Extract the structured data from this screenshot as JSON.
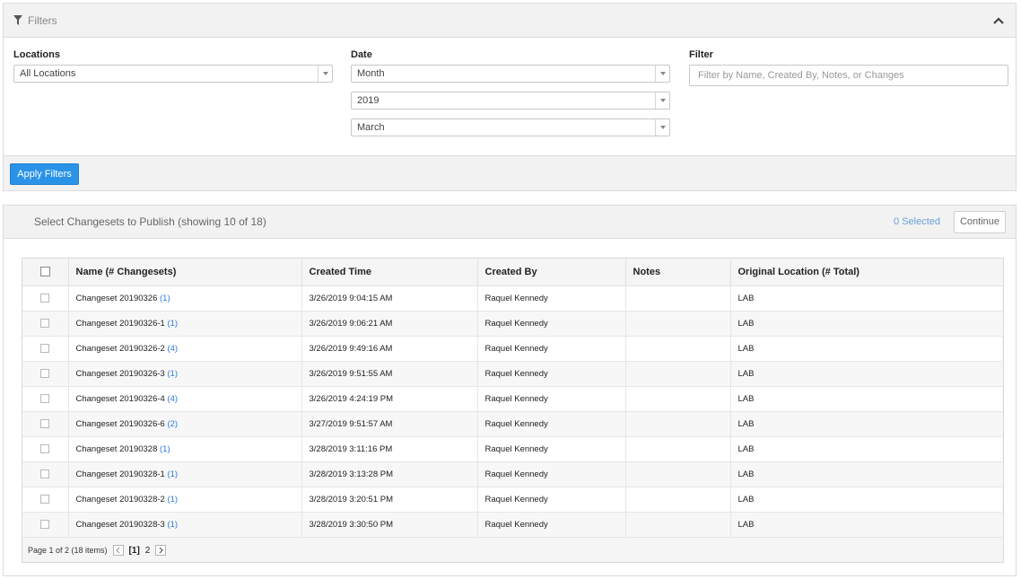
{
  "filters": {
    "title": "Filters",
    "locations": {
      "label": "Locations",
      "value": "All Locations"
    },
    "date": {
      "label": "Date",
      "mode": "Month",
      "year": "2019",
      "month": "March"
    },
    "filter": {
      "label": "Filter",
      "placeholder": "Filter by Name, Created By, Notes, or Changes"
    },
    "apply_label": "Apply Filters"
  },
  "changesets": {
    "title": "Select Changesets to Publish (showing 10 of 18)",
    "selected_count": "0 Selected",
    "continue_label": "Continue",
    "columns": [
      "Name (# Changesets)",
      "Created Time",
      "Created By",
      "Notes",
      "Original Location (# Total)"
    ],
    "rows": [
      {
        "name": "Changeset 20190326",
        "count": "(1)",
        "created_time": "3/26/2019 9:04:15 AM",
        "created_by": "Raquel Kennedy",
        "notes": "",
        "location": "LAB"
      },
      {
        "name": "Changeset 20190326-1",
        "count": "(1)",
        "created_time": "3/26/2019 9:06:21 AM",
        "created_by": "Raquel Kennedy",
        "notes": "",
        "location": "LAB"
      },
      {
        "name": "Changeset 20190326-2",
        "count": "(4)",
        "created_time": "3/26/2019 9:49:16 AM",
        "created_by": "Raquel Kennedy",
        "notes": "",
        "location": "LAB"
      },
      {
        "name": "Changeset 20190326-3",
        "count": "(1)",
        "created_time": "3/26/2019 9:51:55 AM",
        "created_by": "Raquel Kennedy",
        "notes": "",
        "location": "LAB"
      },
      {
        "name": "Changeset 20190326-4",
        "count": "(4)",
        "created_time": "3/26/2019 4:24:19 PM",
        "created_by": "Raquel Kennedy",
        "notes": "",
        "location": "LAB"
      },
      {
        "name": "Changeset 20190326-6",
        "count": "(2)",
        "created_time": "3/27/2019 9:51:57 AM",
        "created_by": "Raquel Kennedy",
        "notes": "",
        "location": "LAB"
      },
      {
        "name": "Changeset 20190328",
        "count": "(1)",
        "created_time": "3/28/2019 3:11:16 PM",
        "created_by": "Raquel Kennedy",
        "notes": "",
        "location": "LAB"
      },
      {
        "name": "Changeset 20190328-1",
        "count": "(1)",
        "created_time": "3/28/2019 3:13:28 PM",
        "created_by": "Raquel Kennedy",
        "notes": "",
        "location": "LAB"
      },
      {
        "name": "Changeset 20190328-2",
        "count": "(1)",
        "created_time": "3/28/2019 3:20:51 PM",
        "created_by": "Raquel Kennedy",
        "notes": "",
        "location": "LAB"
      },
      {
        "name": "Changeset 20190328-3",
        "count": "(1)",
        "created_time": "3/28/2019 3:30:50 PM",
        "created_by": "Raquel Kennedy",
        "notes": "",
        "location": "LAB"
      }
    ],
    "pager": {
      "summary": "Page 1 of 2 (18 items)",
      "pages": [
        "[1]",
        "2"
      ]
    }
  },
  "colors": {
    "accent": "#2a93e8",
    "link": "#2a7bd8",
    "panel_bg": "#f2f2f2"
  },
  "icons": {
    "filters": "funnel-icon",
    "collapse": "chevron-up-icon",
    "select": "caret-down-icon",
    "prev": "chevron-left-icon",
    "next": "chevron-right-icon"
  }
}
